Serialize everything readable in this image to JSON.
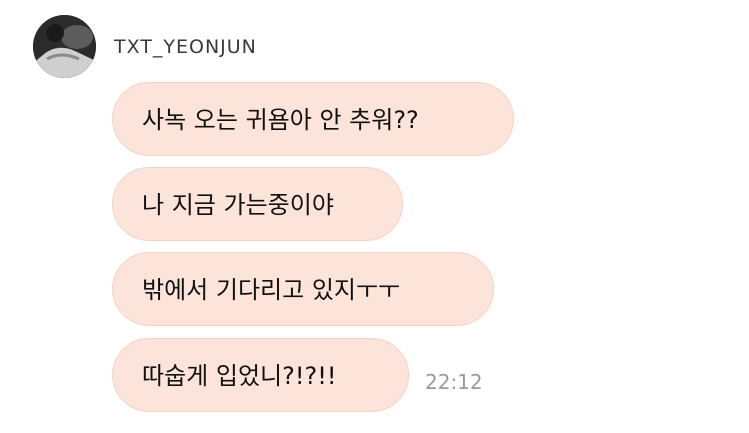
{
  "chat": {
    "sender_name": "TXT_YEONJUN",
    "messages": [
      {
        "text": "사녹 오는 귀욤아 안 추워??"
      },
      {
        "text": "나 지금 가는중이야"
      },
      {
        "text": "밖에서 기다리고 있지ㅜㅜ"
      },
      {
        "text": "따숩게 입었니?!?!!"
      }
    ],
    "timestamp": "22:12"
  },
  "colors": {
    "bubble_background": "#fde4da",
    "bubble_border": "#f5d3c6",
    "timestamp_text": "#9a9a9a"
  },
  "icons": {
    "avatar": "profile-photo-avatar"
  }
}
